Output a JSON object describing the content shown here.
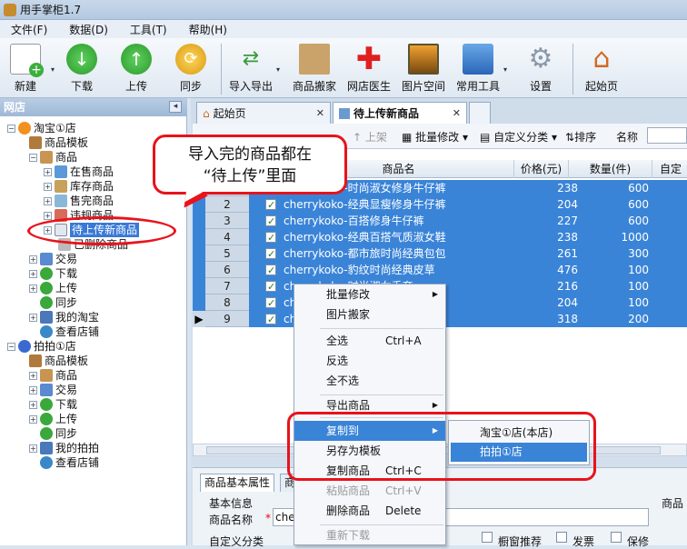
{
  "window": {
    "title": "用手掌柜1.7"
  },
  "menu": [
    "文件(F)",
    "数据(D)",
    "工具(T)",
    "帮助(H)"
  ],
  "toolbar": [
    {
      "label": "新建",
      "icon": "new-icon"
    },
    {
      "label": "下载",
      "icon": "download-icon"
    },
    {
      "label": "上传",
      "icon": "upload-icon"
    },
    {
      "label": "同步",
      "icon": "sync-icon"
    },
    {
      "label": "导入导出",
      "icon": "import-export-icon"
    },
    {
      "label": "商品搬家",
      "icon": "move-goods-icon"
    },
    {
      "label": "网店医生",
      "icon": "doctor-icon"
    },
    {
      "label": "图片空间",
      "icon": "picture-space-icon"
    },
    {
      "label": "常用工具",
      "icon": "tools-icon"
    },
    {
      "label": "设置",
      "icon": "gear-icon"
    },
    {
      "label": "起始页",
      "icon": "home-icon"
    }
  ],
  "left_panel": {
    "title": "网店",
    "tree": [
      "淘宝①店",
      "商品模板",
      "商品",
      "在售商品",
      "库存商品",
      "售完商品",
      "违规商品",
      "待上传新商品",
      "已删除商品",
      "交易",
      "下载",
      "上传",
      "同步",
      "我的淘宝",
      "查看店铺",
      "拍拍①店",
      "商品模板",
      "商品",
      "交易",
      "下载",
      "上传",
      "同步",
      "我的拍拍",
      "查看店铺"
    ]
  },
  "tabs": [
    {
      "label": "起始页"
    },
    {
      "label": "待上传新商品"
    }
  ],
  "subtoolbar": {
    "list_on": "上架",
    "batch_edit": "批量修改",
    "custom_category": "自定义分类",
    "sort": "排序",
    "name_label": "名称"
  },
  "grid": {
    "headers": [
      "商品名",
      "价格(元)",
      "数量(件)",
      "自定"
    ],
    "rows": [
      {
        "no": "1",
        "name": "cherrykoko-时尚淑女修身牛仔裤",
        "price": "238",
        "qty": "600"
      },
      {
        "no": "2",
        "name": "cherrykoko-经典显瘦修身牛仔裤",
        "price": "204",
        "qty": "600"
      },
      {
        "no": "3",
        "name": "cherrykoko-百搭修身牛仔裤",
        "price": "227",
        "qty": "600"
      },
      {
        "no": "4",
        "name": "cherrykoko-经典百搭气质淑女鞋",
        "price": "238",
        "qty": "1000"
      },
      {
        "no": "5",
        "name": "cherrykoko-都市旅时尚经典包包",
        "price": "261",
        "qty": "300"
      },
      {
        "no": "6",
        "name": "cherrykoko-豹纹时尚经典皮草",
        "price": "476",
        "qty": "100"
      },
      {
        "no": "7",
        "name": "cherrykoko-时尚淑女手套",
        "price": "216",
        "qty": "100"
      },
      {
        "no": "8",
        "name": "cherrykoko",
        "price": "204",
        "qty": "100"
      },
      {
        "no": "9",
        "name": "ch",
        "price": "318",
        "qty": "200"
      }
    ]
  },
  "bottom": {
    "tab": "商品基本属性",
    "tab2": "商品",
    "section": "基本信息",
    "name_field": "商品名称",
    "name_value": "cherr",
    "custom": "自定义分类",
    "recommend": "橱窗推荐",
    "invoice": "发票",
    "warranty": "保修",
    "right_label": "商品"
  },
  "context_menu": [
    {
      "label": "批量修改",
      "shortcut": "",
      "arrow": true,
      "disabled": false
    },
    {
      "label": "图片搬家",
      "shortcut": "",
      "arrow": false,
      "disabled": false
    },
    {
      "label": "全选",
      "shortcut": "Ctrl+A",
      "arrow": false,
      "disabled": false
    },
    {
      "label": "反选",
      "shortcut": "",
      "arrow": false,
      "disabled": false
    },
    {
      "label": "全不选",
      "shortcut": "",
      "arrow": false,
      "disabled": false
    },
    {
      "label": "导出商品",
      "shortcut": "",
      "arrow": true,
      "disabled": false
    },
    {
      "label": "复制到",
      "shortcut": "",
      "arrow": true,
      "disabled": false
    },
    {
      "label": "另存为模板",
      "shortcut": "",
      "arrow": false,
      "disabled": false
    },
    {
      "label": "复制商品",
      "shortcut": "Ctrl+C",
      "arrow": false,
      "disabled": false
    },
    {
      "label": "粘贴商品",
      "shortcut": "Ctrl+V",
      "arrow": false,
      "disabled": true
    },
    {
      "label": "删除商品",
      "shortcut": "Delete",
      "arrow": false,
      "disabled": false
    },
    {
      "label": "重新下载",
      "shortcut": "",
      "arrow": false,
      "disabled": true
    }
  ],
  "submenu": [
    "淘宝①店(本店)",
    "拍拍①店"
  ],
  "callout": {
    "line1": "导入完的商品都在",
    "line2": "“待上传”里面"
  }
}
